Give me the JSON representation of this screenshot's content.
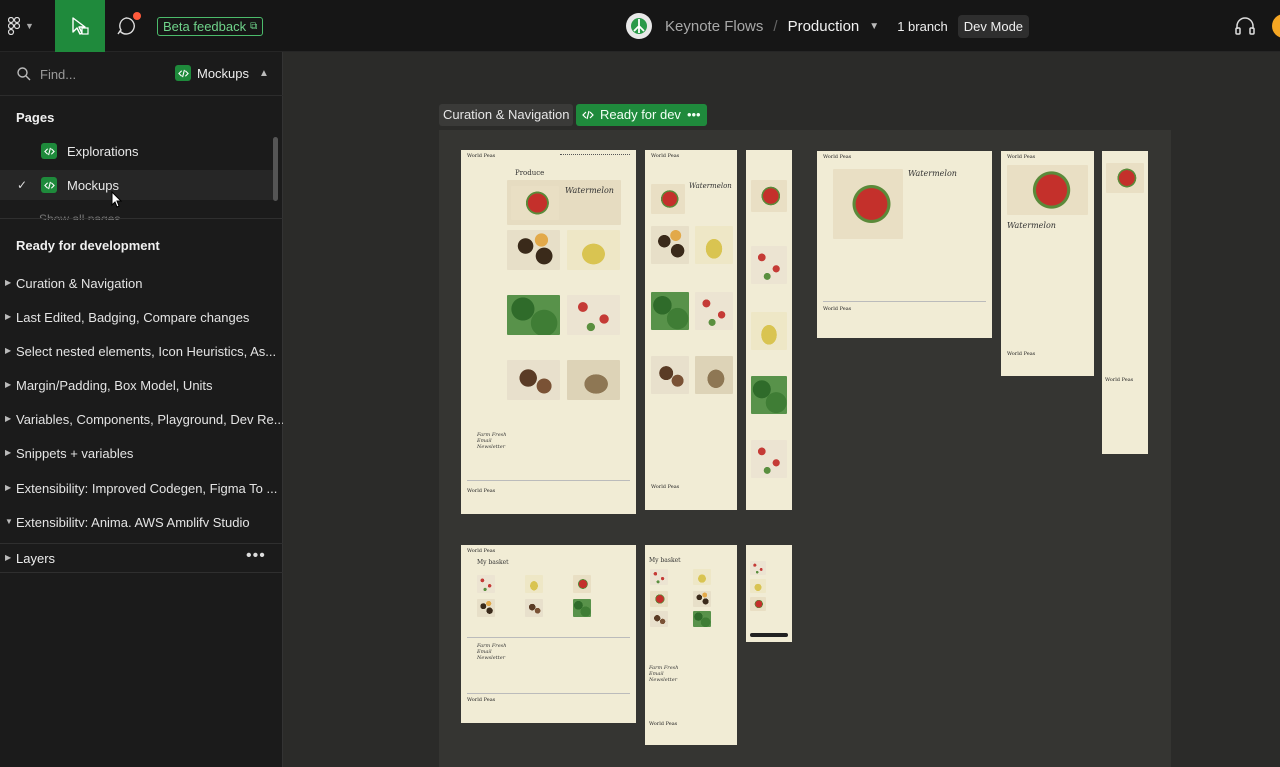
{
  "topbar": {
    "beta_label": "Beta feedback",
    "project": "Keynote Flows",
    "separator": "/",
    "file": "Production",
    "branch": "1 branch",
    "mode": "Dev Mode"
  },
  "sidebar": {
    "find_placeholder": "Find...",
    "page_selector": "Mockups",
    "pages_heading": "Pages",
    "pages": [
      {
        "label": "Explorations",
        "selected": false
      },
      {
        "label": "Mockups",
        "selected": true
      }
    ],
    "show_all": "Show all pages",
    "ready_heading": "Ready for development",
    "sections": [
      "Curation & Navigation",
      "Last Edited, Badging, Compare changes",
      "Select nested elements, Icon Heuristics, As...",
      "Margin/Padding, Box Model, Units",
      "Variables, Components, Playground, Dev Re...",
      "Snippets + variables",
      "Extensibility: Improved Codegen, Figma To ...",
      "Extensibility: Anima, AWS Amplify Studio"
    ],
    "layers_label": "Layers",
    "layers_more": "•••"
  },
  "canvas": {
    "section_name": "Curation & Navigation",
    "ready_label": "Ready for dev",
    "ready_more": "•••",
    "mock_brand": "World Peas",
    "mock_produce": "Produce",
    "mock_product": "Watermelon",
    "mock_basket": "My basket",
    "mock_newsletter": "Farm Fresh Email Newsletter"
  },
  "colors": {
    "accent": "#1f8a3c",
    "topbar_bg": "#161616",
    "sidebar_bg": "#1b1b1b",
    "canvas_bg": "#2b2b29",
    "mock_bg": "#f1ecd5"
  }
}
